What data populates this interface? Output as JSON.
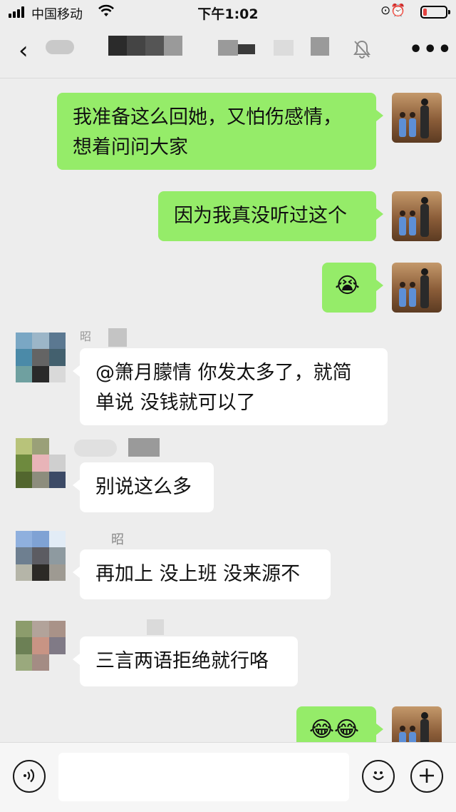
{
  "status_bar": {
    "carrier": "中国移动",
    "time": "下午1:02",
    "battery_fraction": 0.15
  },
  "nav": {
    "back_icon": "chevron-left-icon",
    "mute_icon": "bell-muted-icon",
    "more_icon": "more-dots-icon"
  },
  "messages": [
    {
      "side": "right",
      "text_line1": "我准备这么回她，又怕伤感情，",
      "text_line2": "想着问问大家"
    },
    {
      "side": "right",
      "text": "因为我真没听过这个"
    },
    {
      "side": "right",
      "emoji": "😭"
    },
    {
      "side": "left",
      "sender_partial": "昭",
      "text_line1": "@箫月朦情 你发太多了，就简",
      "text_line2": "单说 没钱就可以了"
    },
    {
      "side": "left",
      "text": "别说这么多"
    },
    {
      "side": "left",
      "sender_partial": "昭",
      "text": "再加上 没上班 没来源不"
    },
    {
      "side": "left",
      "text": "三言两语拒绝就行咯"
    },
    {
      "side": "right",
      "emoji": "😂😂"
    }
  ],
  "input_bar": {
    "voice_icon": "voice-icon",
    "emoji_icon": "emoji-icon",
    "plus_icon": "plus-icon"
  },
  "colors": {
    "background": "#ededed",
    "my_bubble": "#95ec69",
    "other_bubble": "#ffffff",
    "battery_low": "#e64340"
  }
}
